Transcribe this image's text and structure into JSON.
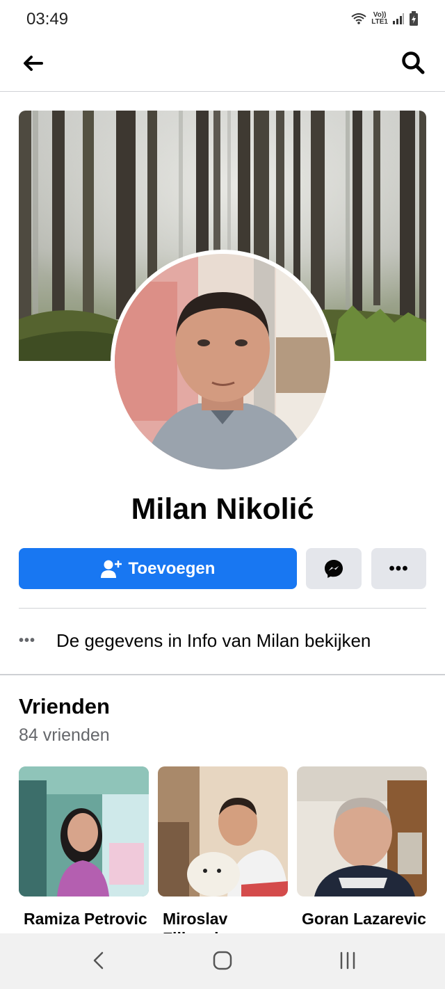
{
  "status_bar": {
    "time": "03:49",
    "network_top": "Vo))",
    "network_bottom": "LTE1"
  },
  "nav": {
    "back_icon": "arrow-left-icon",
    "search_icon": "search-icon"
  },
  "profile": {
    "name": "Milan Nikolić",
    "add_button_label": "Toevoegen",
    "message_icon": "messenger-icon",
    "more_label": "•••"
  },
  "info": {
    "dots": "•••",
    "text": "De gegevens in Info van Milan bekijken"
  },
  "friends": {
    "title": "Vrienden",
    "count": "84 vrienden",
    "items": [
      {
        "name": "Ramiza Petrovic"
      },
      {
        "name": "Miroslav Filipovic"
      },
      {
        "name": "Goran Lazarevic"
      }
    ]
  },
  "colors": {
    "accent": "#1877f2",
    "secondary_button": "#e4e6eb"
  }
}
